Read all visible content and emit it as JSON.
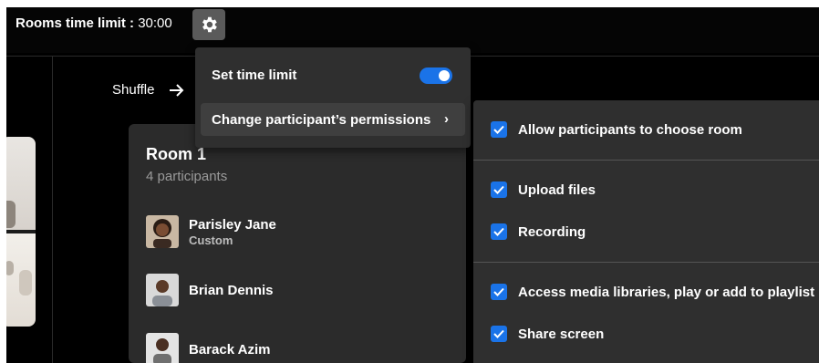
{
  "header": {
    "time_limit_label": "Rooms time limit :",
    "time_limit_value": "30:00",
    "settings_icon": "gear-icon"
  },
  "shuffle": {
    "label": "Shuffle",
    "icon": "arrow-right-icon"
  },
  "settings_menu": {
    "items": [
      {
        "label": "Set time limit",
        "control": "toggle",
        "toggle_on": true
      },
      {
        "label": "Change participant’s permissions",
        "control": "chevron-right-icon"
      }
    ]
  },
  "permissions": {
    "items": [
      {
        "label": "Allow participants to choose room",
        "checked": true
      },
      {
        "label": "Upload files",
        "checked": true
      },
      {
        "label": "Recording",
        "checked": true
      },
      {
        "label": "Access media libraries, play or add to playlist",
        "checked": true
      },
      {
        "label": "Share screen",
        "checked": true
      }
    ]
  },
  "room": {
    "title": "Room 1",
    "participant_count": "4 participants",
    "participants": [
      {
        "name": "Parisley Jane",
        "role": "Custom"
      },
      {
        "name": "Brian Dennis",
        "role": ""
      },
      {
        "name": "Barack Azim",
        "role": ""
      }
    ]
  },
  "colors": {
    "accent": "#1a73e8",
    "background": "#000000",
    "panel": "#2f2f2f",
    "card": "#2b2b2b"
  }
}
